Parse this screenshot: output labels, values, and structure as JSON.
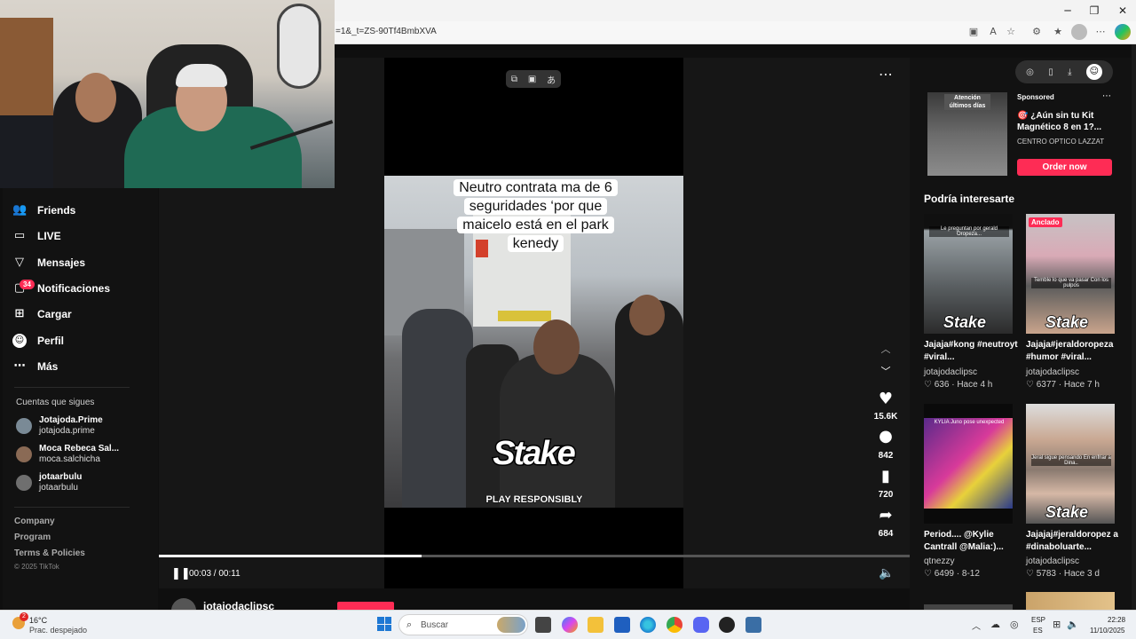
{
  "browser": {
    "url_fragment": "=1&_t=ZS-90Tf4BmbXVA",
    "window_controls": [
      "minimize",
      "maximize",
      "close"
    ],
    "toolbar_icons": [
      "app-icon",
      "read-aloud-icon",
      "favorite-star-icon",
      "extension-icon",
      "favorites-icon",
      "profile-icon",
      "more-icon",
      "copilot-icon"
    ]
  },
  "sidebar": {
    "items": [
      {
        "label": "Friends",
        "icon": "friends-icon"
      },
      {
        "label": "LIVE",
        "icon": "live-icon"
      },
      {
        "label": "Mensajes",
        "icon": "messages-icon"
      },
      {
        "label": "Notificaciones",
        "icon": "notifications-icon",
        "badge": "34"
      },
      {
        "label": "Cargar",
        "icon": "upload-icon"
      },
      {
        "label": "Perfil",
        "icon": "profile-icon"
      },
      {
        "label": "Más",
        "icon": "more-icon"
      }
    ],
    "following_title": "Cuentas que sigues",
    "following": [
      {
        "name": "Jotajoda.Prime",
        "handle": "jotajoda.prime"
      },
      {
        "name": "Moca Rebeca Sal...",
        "handle": "moca.salchicha"
      },
      {
        "name": "jotaarbulu",
        "handle": "jotaarbulu"
      }
    ],
    "footer": [
      "Company",
      "Program",
      "Terms & Policies"
    ],
    "copyright": "© 2025 TikTok"
  },
  "video": {
    "caption": "Neutro contrata ma de 6 seguridades ‘por que maicelo está en el park kenedy",
    "overlay_logo": "Stake",
    "overlay_sub": "PLAY RESPONSIBLY",
    "time_current": "00:03",
    "time_total": "00:11",
    "timecode": "00:03 / 00:11",
    "progress": 0.35,
    "author_peek": "jotajodaclipsc"
  },
  "actions": [
    {
      "name": "like",
      "icon": "heart-icon",
      "count": "15.6K"
    },
    {
      "name": "comment",
      "icon": "comment-icon",
      "count": "842"
    },
    {
      "name": "save",
      "icon": "bookmark-icon",
      "count": "720"
    },
    {
      "name": "share",
      "icon": "share-icon",
      "count": "684"
    }
  ],
  "ad": {
    "thumb_text": "Atención últimos días",
    "sponsored": "Sponsored",
    "title": "🎯 ¿Aún sin tu Kit Magnético 8 en 1?...",
    "brand": "CENTRO OPTICO LAZZAT",
    "cta": "Order now"
  },
  "recommended_title": "Podría interesarte",
  "recommended": [
    {
      "title": "Jajaja#kong #neutroyt #viral...",
      "author": "jotajodaclipsc",
      "meta": "♡ 636 · Hace 4 h",
      "thumb_caption": "Le preguntan por gerald Oropeza...",
      "pinned": ""
    },
    {
      "title": "Jajaja#jeraldoropeza #humor #viral...",
      "author": "jotajodaclipsc",
      "meta": "♡ 6377 · Hace 7 h",
      "thumb_caption": "Temble lo que va pasar Con los pulpos",
      "pinned": "Anclado"
    },
    {
      "title": "Period.... @Kylie Cantrall @Malia:)...",
      "author": "qtnezzy",
      "meta": "♡ 6499 · 8-12",
      "thumb_caption": "KYLIA Juno pose unexpected",
      "pinned": ""
    },
    {
      "title": "Jajajaj#jeraldoropez a #dinaboluarte...",
      "author": "jotajodaclipsc",
      "meta": "♡ 5783 · Hace 3 d",
      "thumb_caption": "Jeral sigue pensando En enfriar a Dina..",
      "pinned": ""
    }
  ],
  "taskbar": {
    "weather_temp": "16°C",
    "weather_desc": "Prac. despejado",
    "weather_badge": "2",
    "search_placeholder": "Buscar",
    "lang_line1": "ESP",
    "lang_line2": "ES",
    "time": "22:28",
    "date": "11/10/2025"
  }
}
